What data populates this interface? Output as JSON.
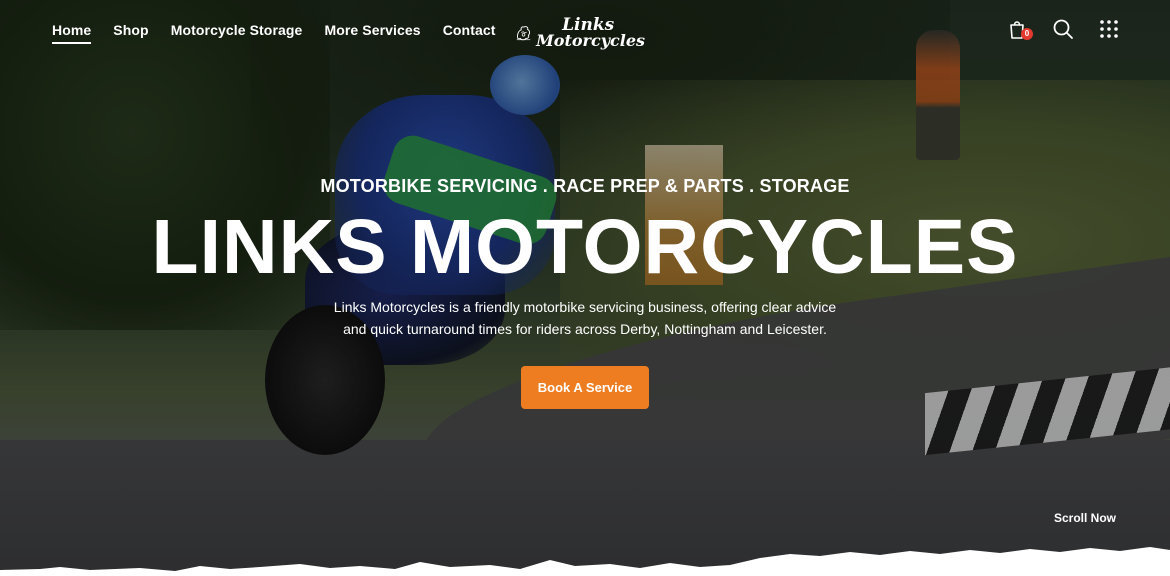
{
  "nav": {
    "items": [
      {
        "label": "Home",
        "active": true
      },
      {
        "label": "Shop",
        "active": false
      },
      {
        "label": "Motorcycle Storage",
        "active": false
      },
      {
        "label": "More Services",
        "active": false
      },
      {
        "label": "Contact",
        "active": false
      }
    ]
  },
  "logo": {
    "line1": "Links",
    "line2": "Motorcycles"
  },
  "header_icons": {
    "cart_icon": "shopping-bag-icon",
    "cart_count": "0",
    "search_icon": "search-icon",
    "menu_icon": "grid-dots-icon"
  },
  "hero": {
    "tagline": "MOTORBIKE SERVICING . RACE PREP & PARTS . STORAGE",
    "title": "LINKS MOTORCYCLES",
    "description": "Links Motorcycles is a friendly motorbike servicing business, offering clear advice and quick turnaround times for riders across Derby, Nottingham and Leicester.",
    "cta_label": "Book A Service",
    "scroll_label": "Scroll Now"
  },
  "colors": {
    "accent": "#ee7d22",
    "badge": "#e23a2e",
    "text": "#ffffff"
  }
}
